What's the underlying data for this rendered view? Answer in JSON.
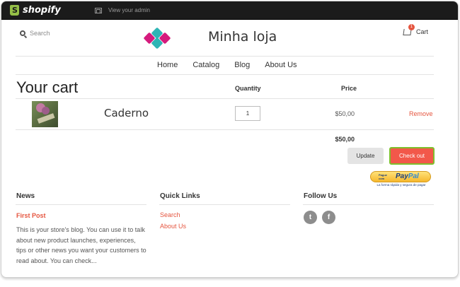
{
  "admin_bar": {
    "brand": "shopify",
    "view_admin": "View your admin"
  },
  "header": {
    "search_label": "Search",
    "store_name": "Minha loja",
    "cart_label": "Cart",
    "cart_count": "1",
    "logo_colors": [
      "#d51b7d",
      "#2fb5b5"
    ]
  },
  "nav": {
    "items": [
      {
        "label": "Home"
      },
      {
        "label": "Catalog"
      },
      {
        "label": "Blog"
      },
      {
        "label": "About Us"
      }
    ]
  },
  "cart": {
    "title": "Your cart",
    "columns": {
      "quantity": "Quantity",
      "price": "Price"
    },
    "items": [
      {
        "name": "Caderno",
        "quantity": "1",
        "price": "$50,00",
        "remove_label": "Remove"
      }
    ],
    "subtotal": "$50,00",
    "update_label": "Update",
    "checkout_label": "Check out",
    "paypal": {
      "small_text": "Pague com",
      "word_pay": "Pay",
      "word_pal": "Pal",
      "subtext": "La forma rápida y segura de pagar"
    }
  },
  "footer": {
    "news": {
      "title": "News",
      "post_title": "First Post",
      "post_excerpt": "This is your store's blog. You can use it to talk about new product launches, experiences, tips or other news you want your customers to read about. You can check..."
    },
    "quick_links": {
      "title": "Quick Links",
      "links": [
        {
          "label": "Search"
        },
        {
          "label": "About Us"
        }
      ]
    },
    "follow_us": {
      "title": "Follow Us",
      "icons": [
        "twitter-icon",
        "facebook-icon"
      ]
    }
  },
  "colors": {
    "accent": "#e5553f",
    "checkout_button": "#f2584a",
    "checkout_border": "#7fbf2c",
    "admin_bar": "#1b1b1b",
    "shopify_green": "#95bf47"
  }
}
